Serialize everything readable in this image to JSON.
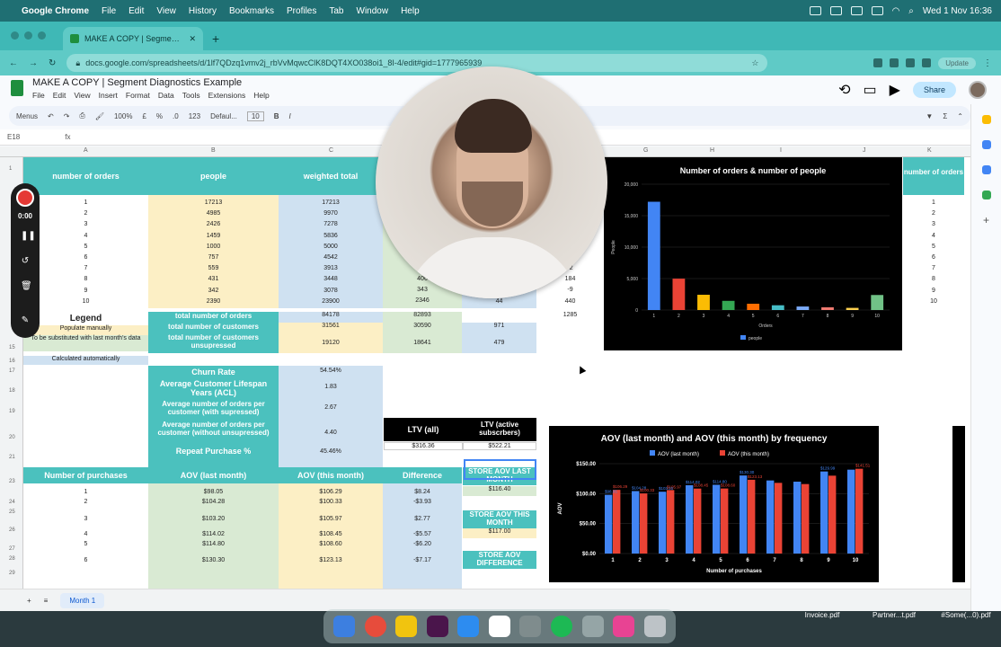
{
  "os_menu": {
    "app": "Google Chrome",
    "items": [
      "File",
      "Edit",
      "View",
      "History",
      "Bookmarks",
      "Profiles",
      "Tab",
      "Window",
      "Help"
    ],
    "clock": "Wed 1 Nov  16:36"
  },
  "browser": {
    "tab_title": "MAKE A COPY | Segment Diagnostics Example",
    "url": "docs.google.com/spreadsheets/d/1lf7QDzq1vmv2j_rbVvMqwcClK8DQT4XO038oi1_8I-4/edit#gid=1777965939",
    "update_label": "Update"
  },
  "doc": {
    "title": "MAKE A COPY | Segment Diagnostics Example",
    "menus": [
      "File",
      "Edit",
      "View",
      "Insert",
      "Format",
      "Data",
      "Tools",
      "Extensions",
      "Help"
    ],
    "share_label": "Share",
    "toolbar": {
      "menus": "Menus",
      "zoom": "100%",
      "currency": "£",
      "percent": "%",
      "decimals": ".0",
      "format": "123",
      "font": "Defaul...",
      "size": "10"
    },
    "cell_ref": "E18",
    "fx": "fx"
  },
  "columns": [
    "A",
    "B",
    "C",
    "G",
    "H",
    "I",
    "J",
    "K"
  ],
  "rows": [
    "1",
    "",
    "",
    "",
    "",
    "",
    "",
    "",
    "",
    "",
    "",
    "15",
    "16",
    "17",
    "18",
    "19",
    "20",
    "21",
    "23",
    "24",
    "25",
    "26",
    "27",
    "28",
    "29"
  ],
  "table_top": {
    "headers": {
      "orders": "number of orders",
      "people": "people",
      "weighted": "weighted total"
    },
    "orders": [
      "1",
      "2",
      "3",
      "4",
      "5",
      "6",
      "7",
      "8",
      "9",
      "10"
    ],
    "people": [
      "17213",
      "4985",
      "2426",
      "1459",
      "1000",
      "757",
      "559",
      "431",
      "342",
      "2390"
    ],
    "weighted": [
      "17213",
      "9970",
      "7278",
      "5836",
      "5000",
      "4542",
      "3913",
      "3448",
      "3078",
      "23900"
    ],
    "col_d_partial": [
      "406",
      "343",
      "2346"
    ],
    "col_e_partial": [
      "44"
    ],
    "col_f_partial": [
      "-2",
      "184",
      "-9",
      "440"
    ],
    "right_orders_header": "number of orders",
    "right_orders": [
      "1",
      "2",
      "3",
      "4",
      "5",
      "6",
      "7",
      "8",
      "9",
      "10"
    ]
  },
  "totals": {
    "total_orders_label": "total number of orders",
    "total_orders": "84178",
    "total_orders_d": "82893",
    "total_orders_f": "1285",
    "total_customers_label": "total number of customers",
    "total_customers": "31561",
    "total_customers_d": "30590",
    "total_customers_e": "971",
    "unsupressed_label": "total number of customers unsupressed",
    "unsupressed": "19120",
    "unsupressed_d": "18641",
    "unsupressed_e": "479"
  },
  "legend": {
    "title": "Legend",
    "manual": "Populate manually",
    "substitute": "To be substituted with last month's data",
    "auto": "Calculated automatically"
  },
  "metrics": [
    {
      "label": "Churn Rate",
      "value": "54.54%"
    },
    {
      "label": "Average Customer Lifespan Years (ACL)",
      "value": "1.83"
    },
    {
      "label": "Average number of orders per customer (with supressed)",
      "value": "2.67"
    },
    {
      "label": "Average number of orders per customer (without unsupressed)",
      "value": "4.40"
    },
    {
      "label": "Repeat Purchase %",
      "value": "45.46%"
    }
  ],
  "ltv": {
    "all_label": "LTV (all)",
    "all": "$316.36",
    "active_label": "LTV (active subscrbers)",
    "active": "$522.21"
  },
  "aov_table": {
    "headers": [
      "Number of purchases",
      "AOV (last month)",
      "AOV (this month)",
      "Difference"
    ],
    "rows": [
      [
        "1",
        "$98.05",
        "$106.29",
        "$8.24"
      ],
      [
        "2",
        "$104.28",
        "$100.33",
        "-$3.93"
      ],
      [
        "3",
        "$103.20",
        "$105.97",
        "$2.77"
      ],
      [
        "4",
        "$114.02",
        "$108.45",
        "-$5.57"
      ],
      [
        "5",
        "$114.80",
        "$108.60",
        "-$6.20"
      ],
      [
        "6",
        "$130.30",
        "$123.13",
        "-$7.17"
      ]
    ],
    "store_last_label": "STORE AOV LAST MONTH",
    "store_last": "$116.40",
    "store_this_label": "STORE AOV THIS MONTH",
    "store_this": "$117.00",
    "store_diff_label": "STORE AOV DIFFERENCE"
  },
  "chart_data": [
    {
      "type": "bar",
      "title": "Number of orders & number of people",
      "xlabel": "Orders",
      "ylabel": "People",
      "categories": [
        "1",
        "2",
        "3",
        "4",
        "5",
        "6",
        "7",
        "8",
        "9",
        "10"
      ],
      "series": [
        {
          "name": "people",
          "values": [
            17213,
            4985,
            2426,
            1459,
            1000,
            757,
            559,
            431,
            342,
            2390
          ]
        }
      ],
      "ylim": [
        0,
        20000
      ],
      "yticks": [
        "0",
        "5,000",
        "10,000",
        "15,000",
        "20,000"
      ],
      "colors": [
        "#4285f4",
        "#ea4335",
        "#fbbc04",
        "#34a853",
        "#ff6d01",
        "#46bdc6",
        "#7baaf7",
        "#f07b72",
        "#fcd04f",
        "#71c287"
      ],
      "legend": "bottom"
    },
    {
      "type": "bar",
      "title": "AOV (last month) and AOV (this month) by frequency",
      "xlabel": "Number of purchases",
      "ylabel": "AOV",
      "categories": [
        "1",
        "2",
        "3",
        "4",
        "5",
        "6",
        "7",
        "8",
        "9",
        "10"
      ],
      "series": [
        {
          "name": "AOV (last month)",
          "color": "#4285f4",
          "values": [
            98.05,
            104.28,
            103.2,
            114.02,
            114.8,
            130.3,
            122,
            120,
            137,
            140
          ]
        },
        {
          "name": "AOV (this month)",
          "color": "#ea4335",
          "values": [
            106.29,
            100.33,
            105.97,
            108.45,
            108.6,
            123.13,
            118,
            116,
            129.99,
            141.51
          ]
        }
      ],
      "data_labels_visible": [
        "$98.05",
        "$106.29",
        "$104.28",
        "$100.33",
        "$103.20",
        "$105.97",
        "$114.02",
        "$108.45",
        "$114.80",
        "$108.60",
        "$130.30",
        "$123.13",
        "$129.99",
        "$141.51"
      ],
      "ylim": [
        0,
        150
      ],
      "yticks": [
        "$0.00",
        "$50.00",
        "$100.00",
        "$150.00"
      ],
      "legend": "top"
    }
  ],
  "recorder": {
    "time": "0:00"
  },
  "sheet_tab": "Month 1",
  "desktop_files": [
    "Invoice.pdf",
    "Partner...t.pdf",
    "#Some(...0).pdf"
  ]
}
